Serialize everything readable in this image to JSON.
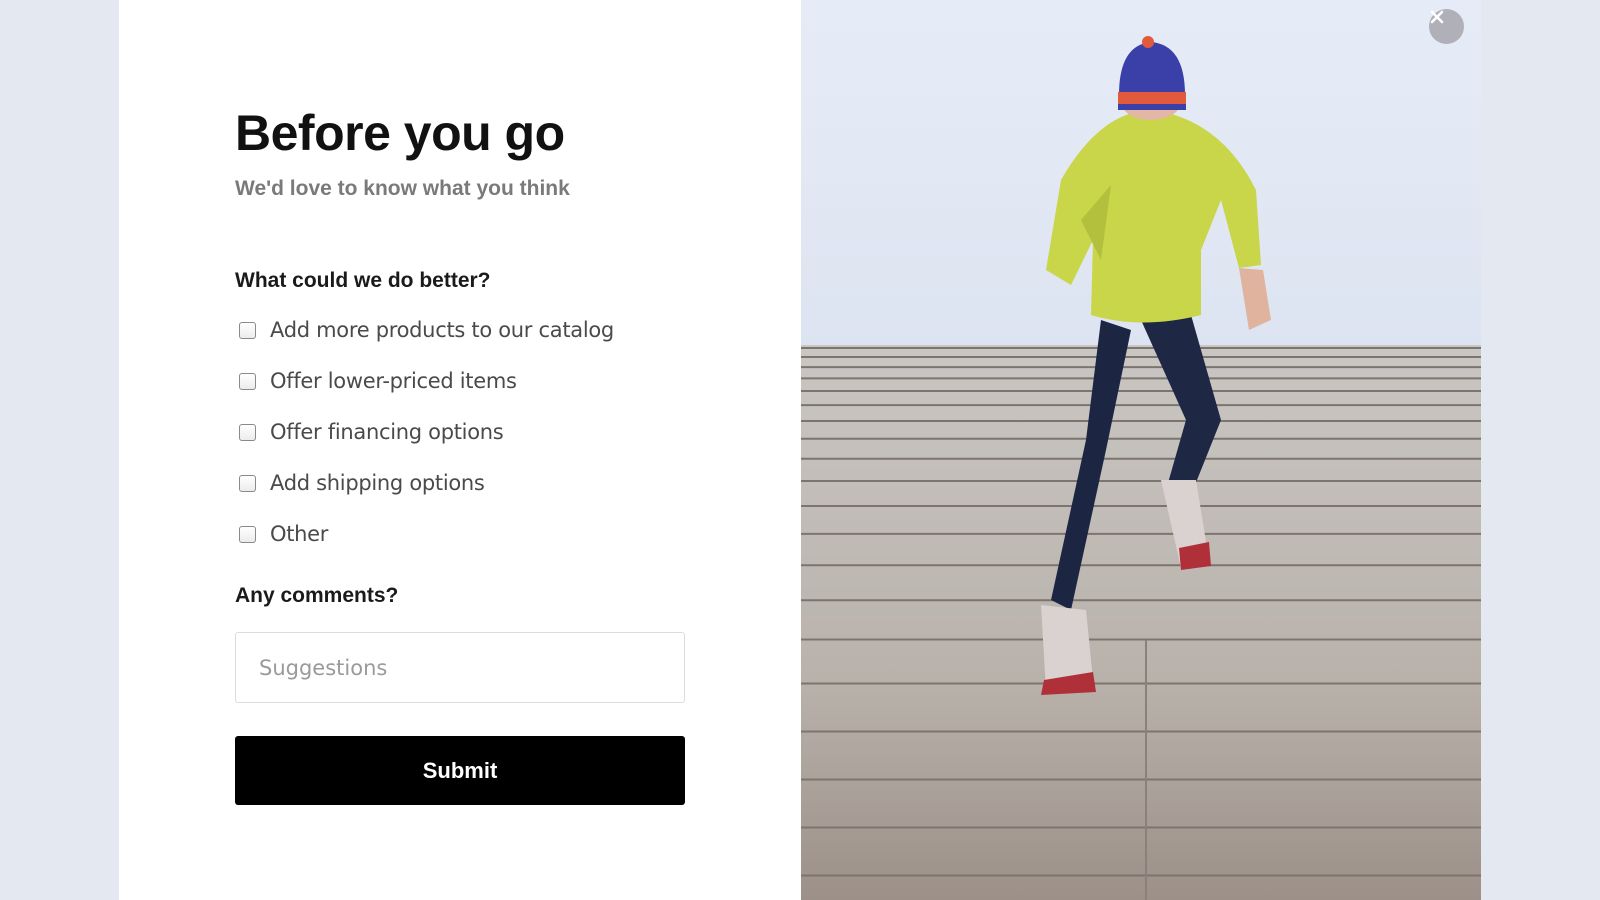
{
  "modal": {
    "title": "Before you go",
    "subtitle": "We'd love to know what you think",
    "question_improve": "What could we do better?",
    "options": [
      {
        "label": "Add more products to our catalog",
        "checked": false
      },
      {
        "label": "Offer lower-priced items",
        "checked": false
      },
      {
        "label": "Offer financing options",
        "checked": false
      },
      {
        "label": "Add shipping options",
        "checked": false
      },
      {
        "label": "Other",
        "checked": false
      }
    ],
    "question_comments": "Any comments?",
    "comments_placeholder": "Suggestions",
    "comments_value": "",
    "submit_label": "Submit"
  },
  "photo": {
    "subject": "runner-climbing-stairs",
    "close_icon": "close-icon"
  },
  "colors": {
    "page_background": "#e4e8f1",
    "submit_background": "#000000",
    "subtitle_text": "#7a7a7a",
    "close_button": "#b0b0b8"
  }
}
